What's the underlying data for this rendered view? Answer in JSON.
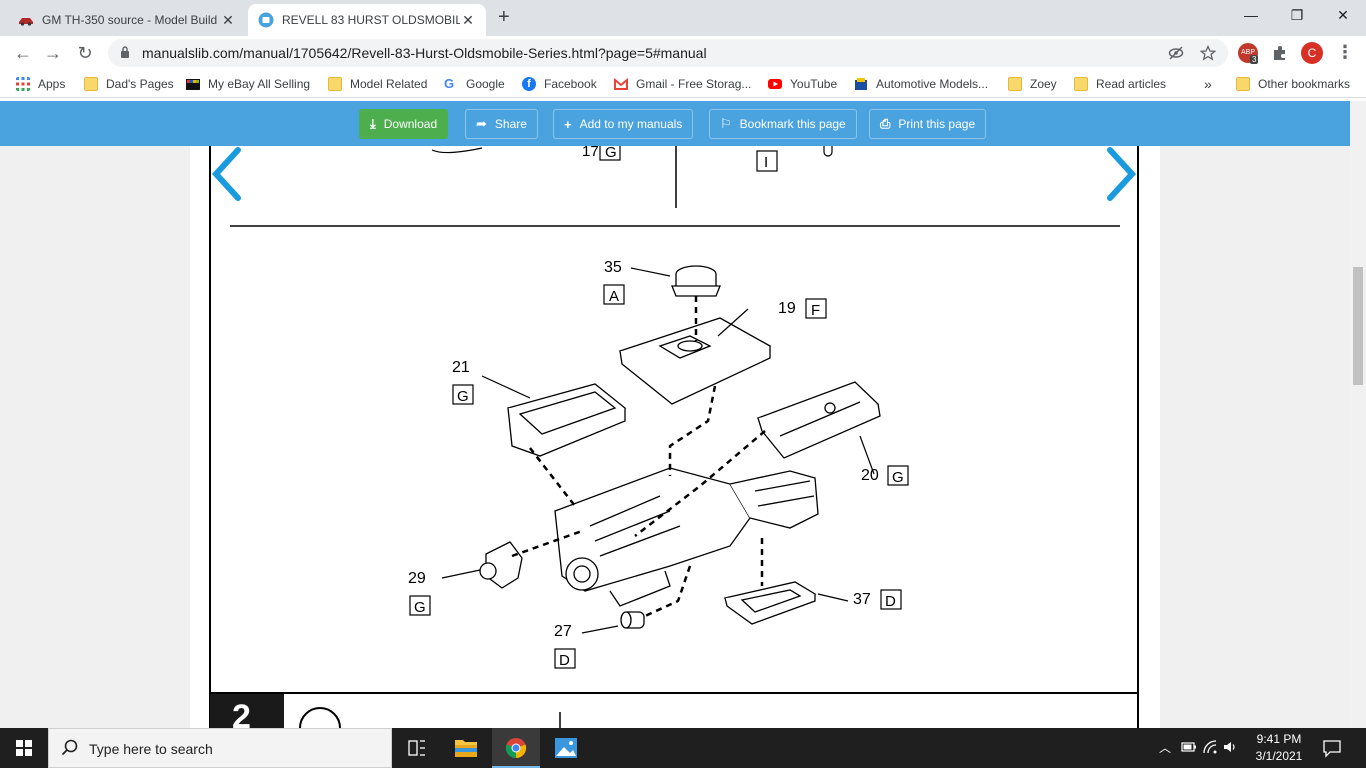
{
  "tabs": [
    {
      "title": "GM TH-350 source - Model Build",
      "close": "✕"
    },
    {
      "title": "REVELL 83 HURST OLDSMOBILE",
      "close": "✕"
    }
  ],
  "new_tab": "+",
  "window_controls": {
    "minimize": "—",
    "maximize": "❐",
    "close": "✕"
  },
  "nav": {
    "back": "←",
    "forward": "→",
    "reload": "↻"
  },
  "address": {
    "url": "manualslib.com/manual/1705642/Revell-83-Hurst-Oldsmobile-Series.html?page=5#manual"
  },
  "extensions": {
    "abp_badge": "3",
    "profile_initial": "C",
    "menu": "⋮"
  },
  "bookmarks": [
    {
      "label": "Apps",
      "icon": "apps-grid-icon"
    },
    {
      "label": "Dad's Pages",
      "icon": "folder-icon"
    },
    {
      "label": "My eBay All Selling",
      "icon": "ebay-icon"
    },
    {
      "label": "Model Related",
      "icon": "folder-icon"
    },
    {
      "label": "Google",
      "icon": "google-icon"
    },
    {
      "label": "Facebook",
      "icon": "facebook-icon"
    },
    {
      "label": "Gmail - Free Storag...",
      "icon": "gmail-icon"
    },
    {
      "label": "YouTube",
      "icon": "youtube-icon"
    },
    {
      "label": "Automotive Models...",
      "icon": "automotive-icon"
    },
    {
      "label": "Zoey",
      "icon": "folder-icon"
    },
    {
      "label": "Read articles",
      "icon": "folder-icon"
    }
  ],
  "bookmarks_overflow": "»",
  "other_bookmarks": "Other bookmarks",
  "actions": {
    "download": "Download",
    "share": "Share",
    "add": "Add to my manuals",
    "bookmark": "Bookmark this page",
    "print": "Print this page"
  },
  "manual": {
    "top_fragment": {
      "part": "17",
      "letter1": "G",
      "letter2": "I"
    },
    "parts": [
      {
        "num": "35",
        "letter": "A"
      },
      {
        "num": "19",
        "letter": "F"
      },
      {
        "num": "21",
        "letter": "G"
      },
      {
        "num": "20",
        "letter": "G"
      },
      {
        "num": "29",
        "letter": "G"
      },
      {
        "num": "37",
        "letter": "D"
      },
      {
        "num": "27",
        "letter": "D"
      }
    ],
    "next_step": "2"
  },
  "taskbar": {
    "search_placeholder": "Type here to search",
    "time": "9:41 PM",
    "date": "3/1/2021"
  },
  "colors": {
    "action_bar": "#4aa3df",
    "download_green": "#4cae4c",
    "nav_arrow": "#1a9be0"
  }
}
